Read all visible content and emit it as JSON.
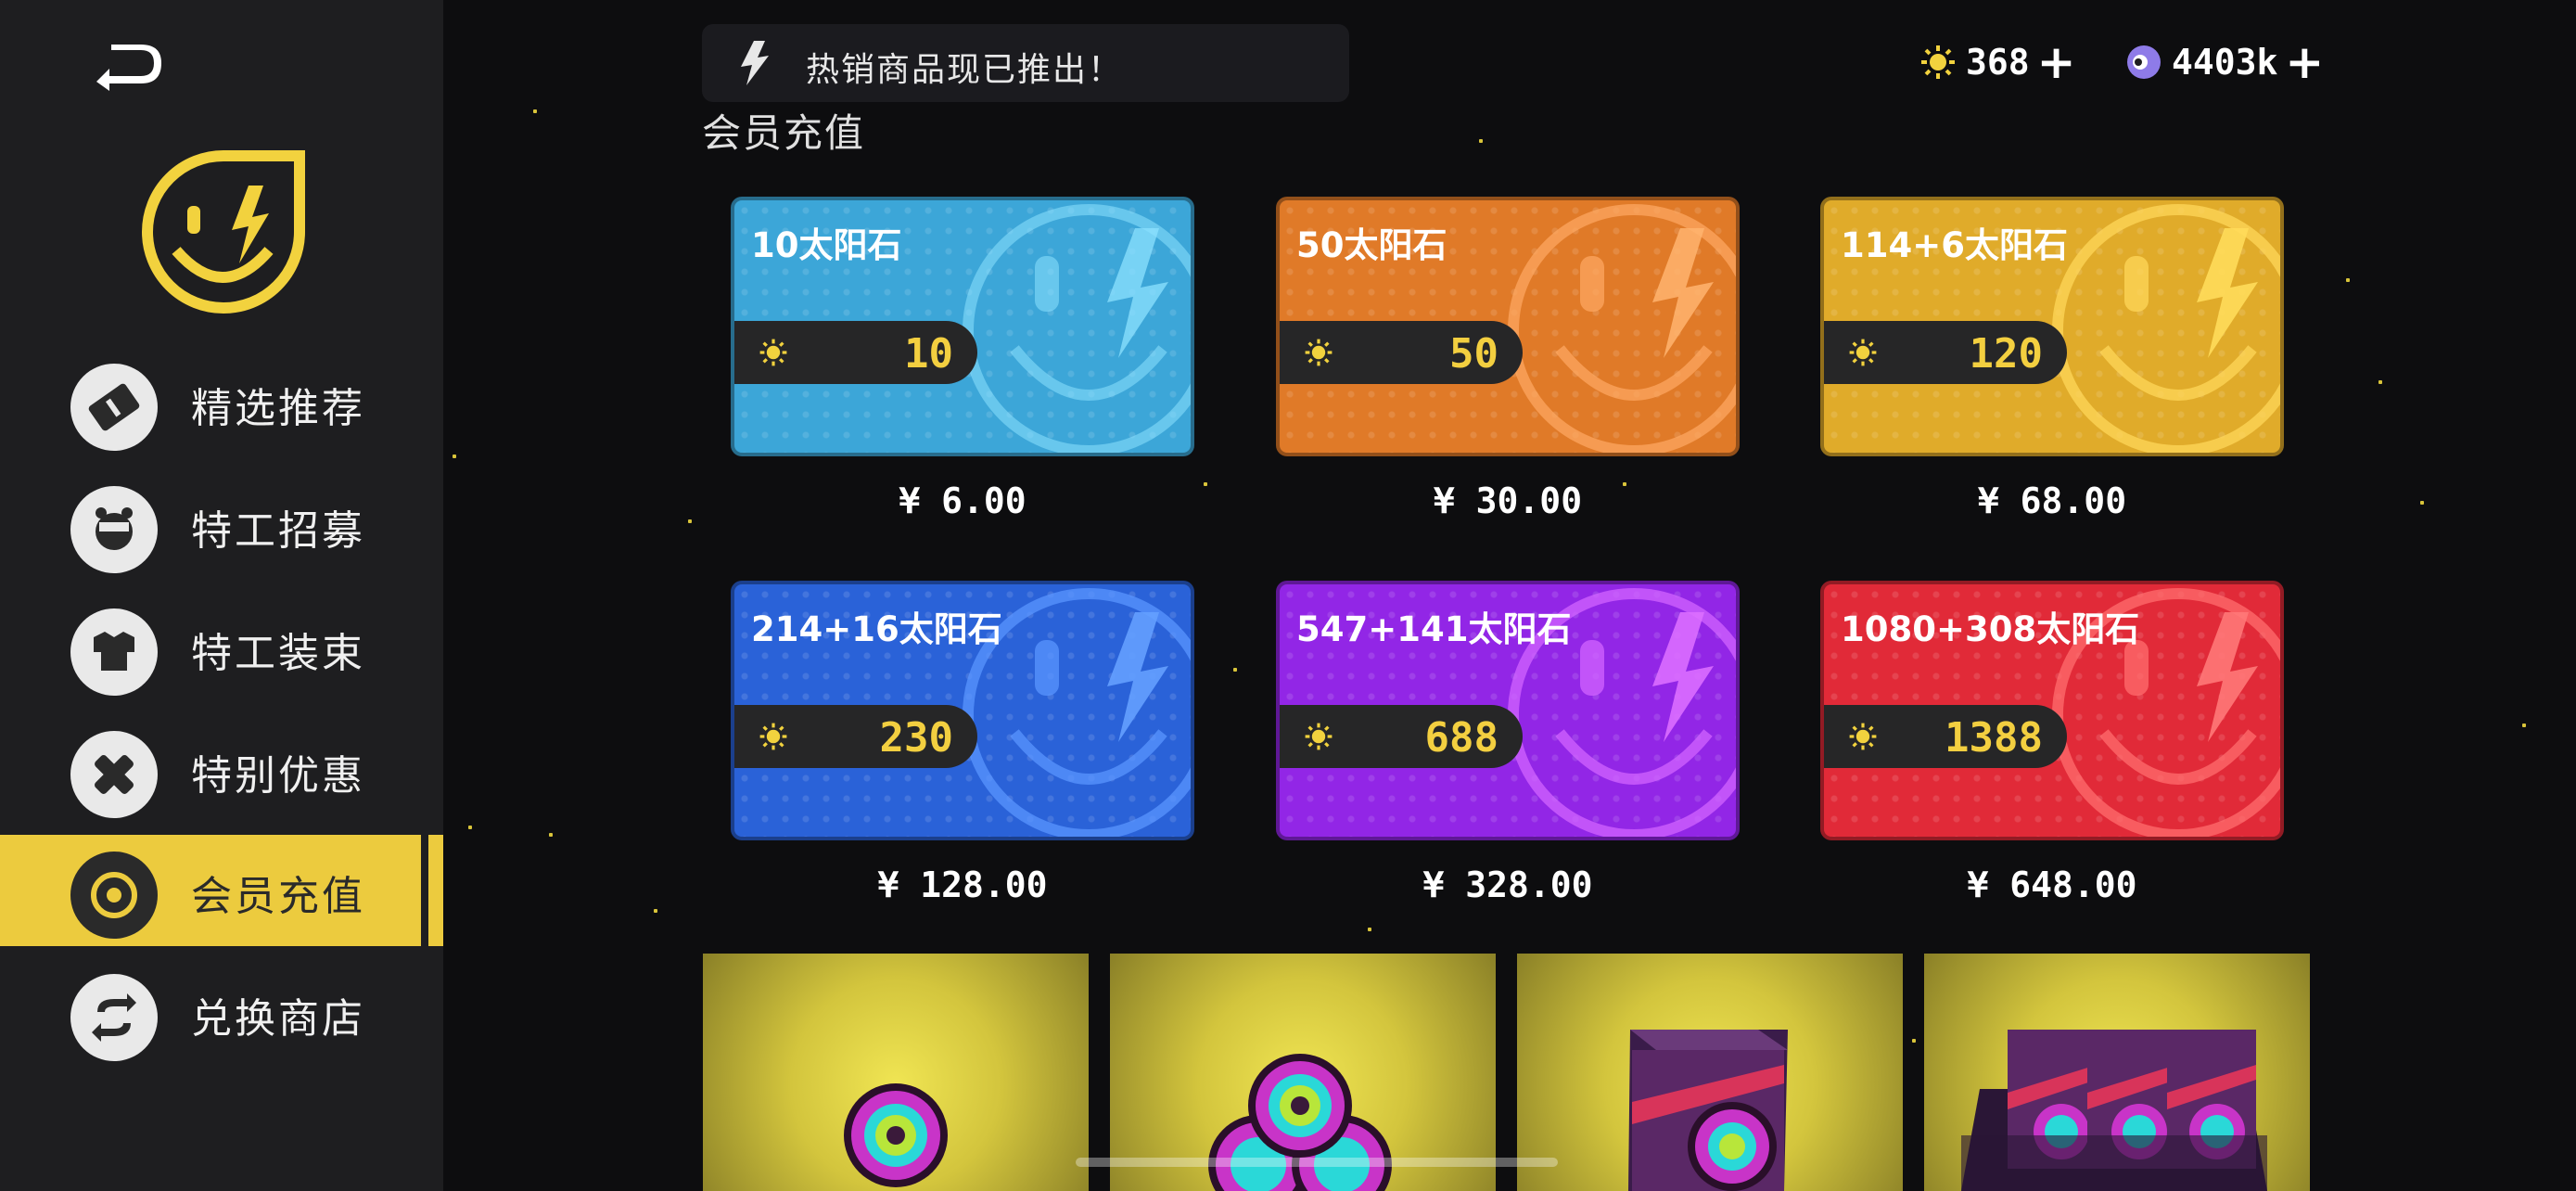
{
  "notice": {
    "text": "热销商品现已推出！"
  },
  "currencies": [
    {
      "icon": "sunstone-icon",
      "value": "368"
    },
    {
      "icon": "orb-icon",
      "value": "4403k"
    }
  ],
  "section_title": "会员充值",
  "nav": [
    {
      "label": "精选推荐",
      "icon": "ticket-icon"
    },
    {
      "label": "特工招募",
      "icon": "agent-icon"
    },
    {
      "label": "特工装束",
      "icon": "outfit-icon"
    },
    {
      "label": "特别优惠",
      "icon": "bandage-icon"
    },
    {
      "label": "会员充值",
      "icon": "target-icon",
      "active": true
    },
    {
      "label": "兑换商店",
      "icon": "exchange-icon"
    }
  ],
  "packs": [
    {
      "name": "10太阳石",
      "amount": "10",
      "price": "¥ 6.00",
      "color": "#3ca6d8"
    },
    {
      "name": "50太阳石",
      "amount": "50",
      "price": "¥ 30.00",
      "color": "#e07a28"
    },
    {
      "name": "114+6太阳石",
      "amount": "120",
      "price": "¥ 68.00",
      "color": "#e0ab2a"
    },
    {
      "name": "214+16太阳石",
      "amount": "230",
      "price": "¥ 128.00",
      "color": "#2a62d8"
    },
    {
      "name": "547+141太阳石",
      "amount": "688",
      "price": "¥ 328.00",
      "color": "#9226e6"
    },
    {
      "name": "1080+308太阳石",
      "amount": "1388",
      "price": "¥ 648.00",
      "color": "#e12a38"
    }
  ]
}
